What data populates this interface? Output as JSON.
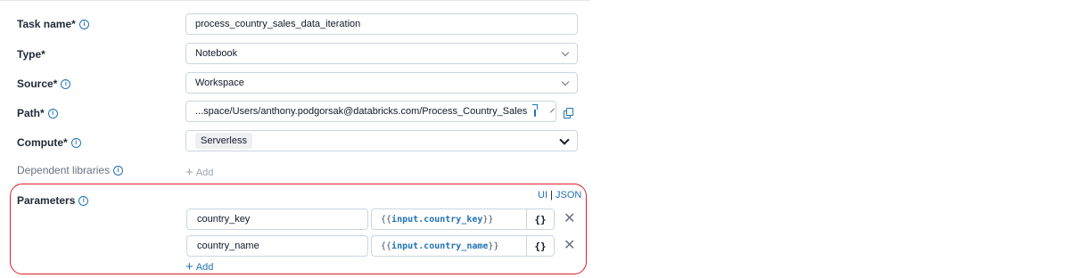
{
  "form": {
    "task_name": {
      "label": "Task name*",
      "value": "process_country_sales_data_iteration"
    },
    "type": {
      "label": "Type*",
      "value": "Notebook"
    },
    "source": {
      "label": "Source*",
      "value": "Workspace"
    },
    "path": {
      "label": "Path*",
      "value": "...space/Users/anthony.podgorsak@databricks.com/Process_Country_Sales"
    },
    "compute": {
      "label": "Compute*",
      "value": "Serverless"
    },
    "dependent_libraries": {
      "label": "Dependent libraries",
      "add_label": "Add"
    }
  },
  "parameters": {
    "label": "Parameters",
    "toggle_ui": "UI",
    "toggle_sep": "|",
    "toggle_json": "JSON",
    "rows": [
      {
        "key": "country_key",
        "value_open": "{{",
        "value_ref": "input.country_key",
        "value_close": "}}"
      },
      {
        "key": "country_name",
        "value_open": "{{",
        "value_ref": "input.country_name",
        "value_close": "}}"
      }
    ],
    "brace_label": "{}",
    "add_label": "Add"
  },
  "colors": {
    "accent": "#2272b4",
    "highlight_border": "#e11d2a",
    "muted_text": "#6b7280"
  },
  "icons": [
    "info-icon",
    "chevron-down-icon",
    "external-link-icon",
    "copy-icon",
    "plus-icon",
    "close-icon"
  ]
}
